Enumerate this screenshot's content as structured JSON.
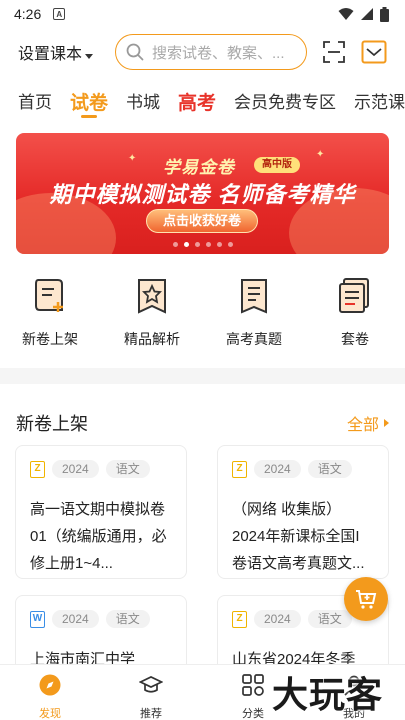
{
  "status_bar": {
    "time": "4:26",
    "notif_glyph": "A"
  },
  "header": {
    "set_course_label": "设置课本",
    "search_placeholder": "搜索试卷、教案、..."
  },
  "tabs": [
    {
      "label": "首页"
    },
    {
      "label": "试卷"
    },
    {
      "label": "书城"
    },
    {
      "label": "高考"
    },
    {
      "label": "会员免费专区"
    },
    {
      "label": "示范课"
    }
  ],
  "banner": {
    "brand": "学易金卷",
    "badge": "高中版",
    "title": "期中模拟测试卷 名师备考精华",
    "button_label": "点击收获好卷",
    "page_count": 6,
    "active_page": 1
  },
  "quick_entries": [
    {
      "label": "新卷上架",
      "icon": "new-paper-icon"
    },
    {
      "label": "精品解析",
      "icon": "star-book-icon"
    },
    {
      "label": "高考真题",
      "icon": "exam-doc-icon"
    },
    {
      "label": "套卷",
      "icon": "paper-set-icon"
    }
  ],
  "section": {
    "title": "新卷上架",
    "more_label": "全部"
  },
  "cards": [
    {
      "file_glyph": "Z",
      "year": "2024",
      "subject": "语文",
      "title": "高一语文期中模拟卷01（统编版通用，必修上册1~4..."
    },
    {
      "file_glyph": "Z",
      "year": "2024",
      "subject": "语文",
      "title": "（网络 收集版）2024年新课标全国I卷语文高考真题文..."
    },
    {
      "file_glyph": "W",
      "year": "2024",
      "subject": "语文",
      "title": "上海市南汇中学"
    },
    {
      "file_glyph": "Z",
      "year": "2024",
      "subject": "语文",
      "title": "山东省2024年冬季"
    }
  ],
  "bottom_nav": [
    {
      "label": "发现",
      "icon": "discover-icon"
    },
    {
      "label": "推荐",
      "icon": "graduation-cap-icon"
    },
    {
      "label": "分类",
      "icon": "category-grid-icon"
    },
    {
      "label": "我的",
      "icon": "profile-icon"
    }
  ],
  "watermark": "大玩客",
  "colors": {
    "accent": "#f39a1c",
    "hot": "#e8332a",
    "banner_red": "#e52a28"
  }
}
